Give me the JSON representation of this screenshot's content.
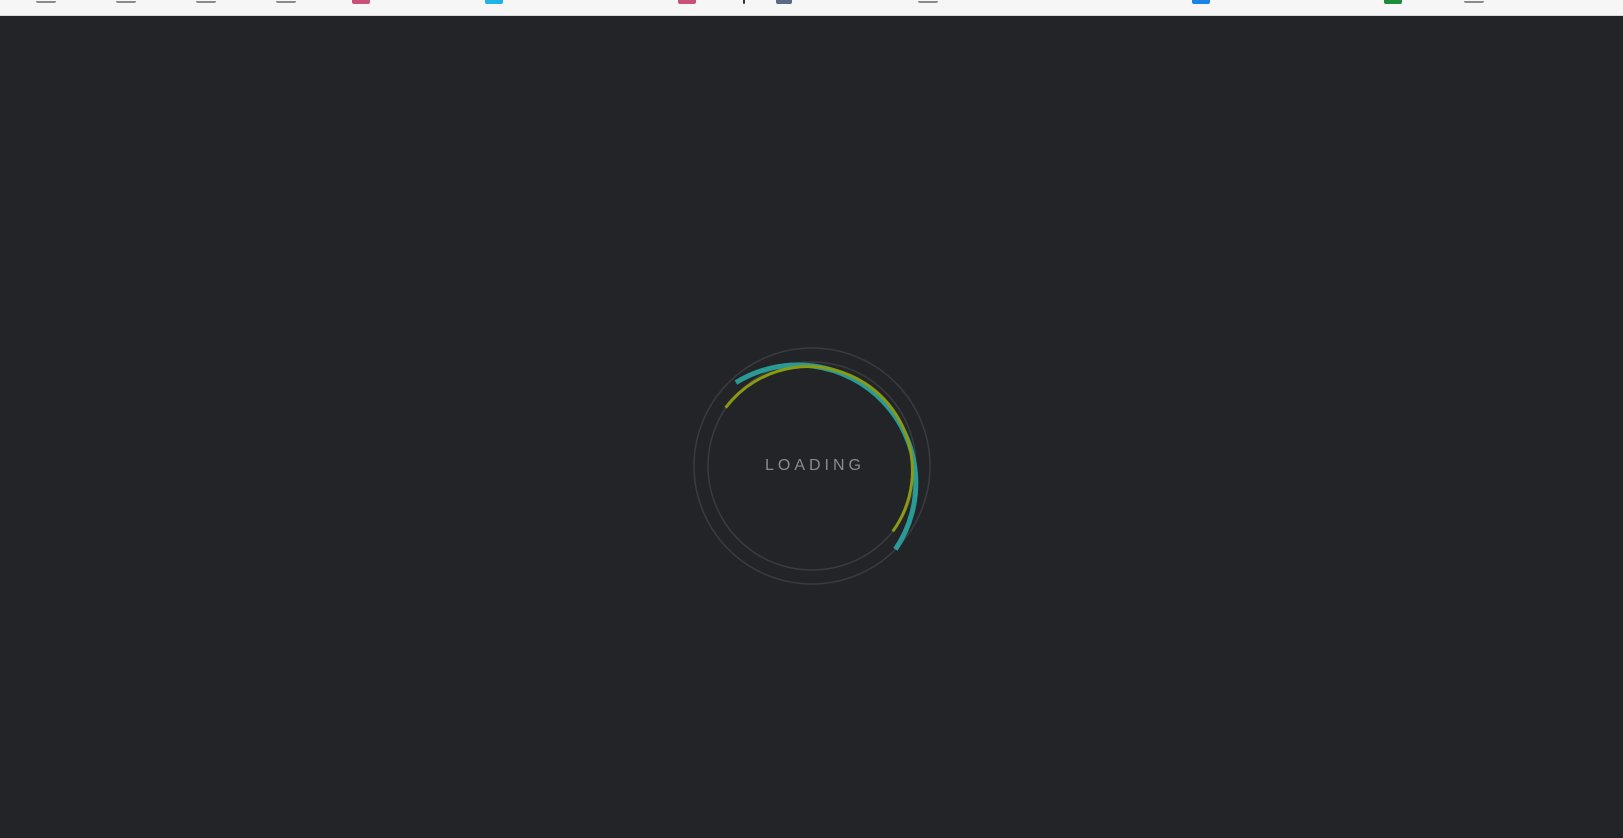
{
  "bookmarks_bar": {
    "items": [
      {
        "icon": "folder-icon",
        "color": "#8a8a8a"
      },
      {
        "icon": "folder-icon",
        "color": "#8a8a8a"
      },
      {
        "icon": "folder-icon",
        "color": "#8a8a8a"
      },
      {
        "icon": "folder-icon",
        "color": "#8a8a8a"
      },
      {
        "icon": "site-favicon",
        "color": "#c9507a"
      },
      {
        "icon": "site-favicon",
        "color": "#1fb3e6"
      },
      {
        "icon": "site-favicon",
        "color": "#c9507a"
      },
      {
        "icon": "site-favicon",
        "color": "#5b6b86"
      },
      {
        "icon": "folder-icon",
        "color": "#8a8a8a"
      },
      {
        "icon": "site-favicon",
        "color": "#1a84e6"
      },
      {
        "icon": "site-favicon",
        "color": "#1e8c3a"
      },
      {
        "icon": "folder-icon",
        "color": "#8a8a8a"
      }
    ]
  },
  "loader": {
    "label": "LOADING",
    "colors": {
      "outer_arc": "#2a9a96",
      "inner_arc": "#8a9a12",
      "track": "#3a3b40",
      "background": "#232428"
    }
  }
}
